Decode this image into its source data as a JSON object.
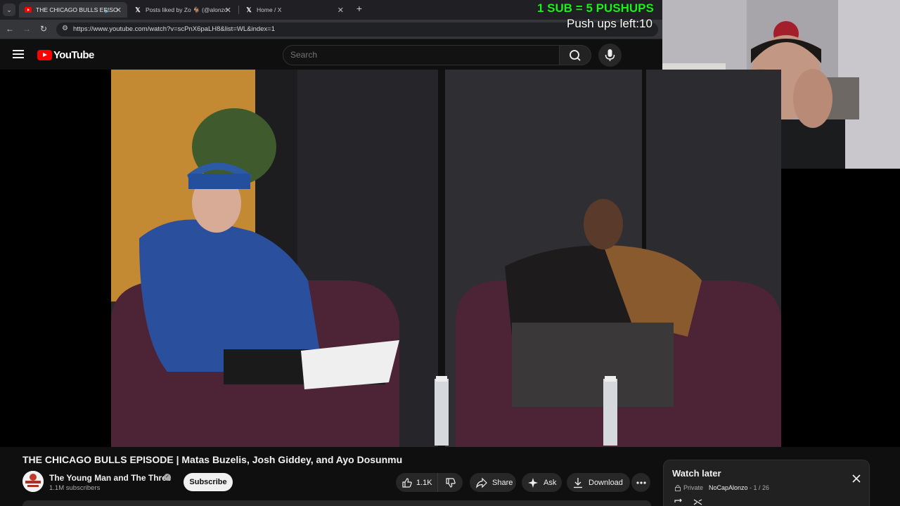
{
  "browser": {
    "tabs": [
      {
        "title": "THE CHICAGO BULLS EPISO",
        "active": true
      },
      {
        "title": "Posts liked by Zo 🐐 (@alonzo",
        "active": false
      },
      {
        "title": "Home / X",
        "active": false
      }
    ],
    "new_tab_symbol": "+",
    "url": "https://www.youtube.com/watch?v=scPnX6paLH8&list=WL&index=1"
  },
  "overlay": {
    "sub_text": "1 SUB = 5 PUSHUPS",
    "pushups_text": "Push ups left:10"
  },
  "header": {
    "logo_text": "YouTube",
    "search_placeholder": "Search"
  },
  "video": {
    "title": "THE CHICAGO BULLS EPISODE | Matas Buzelis, Josh Giddey, and Ayo Dosunmu",
    "channel": {
      "name": "The Young Man and The Three",
      "subscribers": "1.1M subscribers",
      "avatar_text": "THE YOUNG MAN"
    },
    "subscribe_label": "Subscribe",
    "actions": {
      "likes": "1.1K",
      "share": "Share",
      "ask": "Ask",
      "download": "Download"
    }
  },
  "watch_later": {
    "title": "Watch later",
    "privacy": "Private",
    "owner": "NoCapAlonzo",
    "position": " - 1 / 26"
  },
  "colors": {
    "accent_red": "#ff0000",
    "overlay_green": "#1bf21b",
    "background": "#0f0f0f"
  }
}
